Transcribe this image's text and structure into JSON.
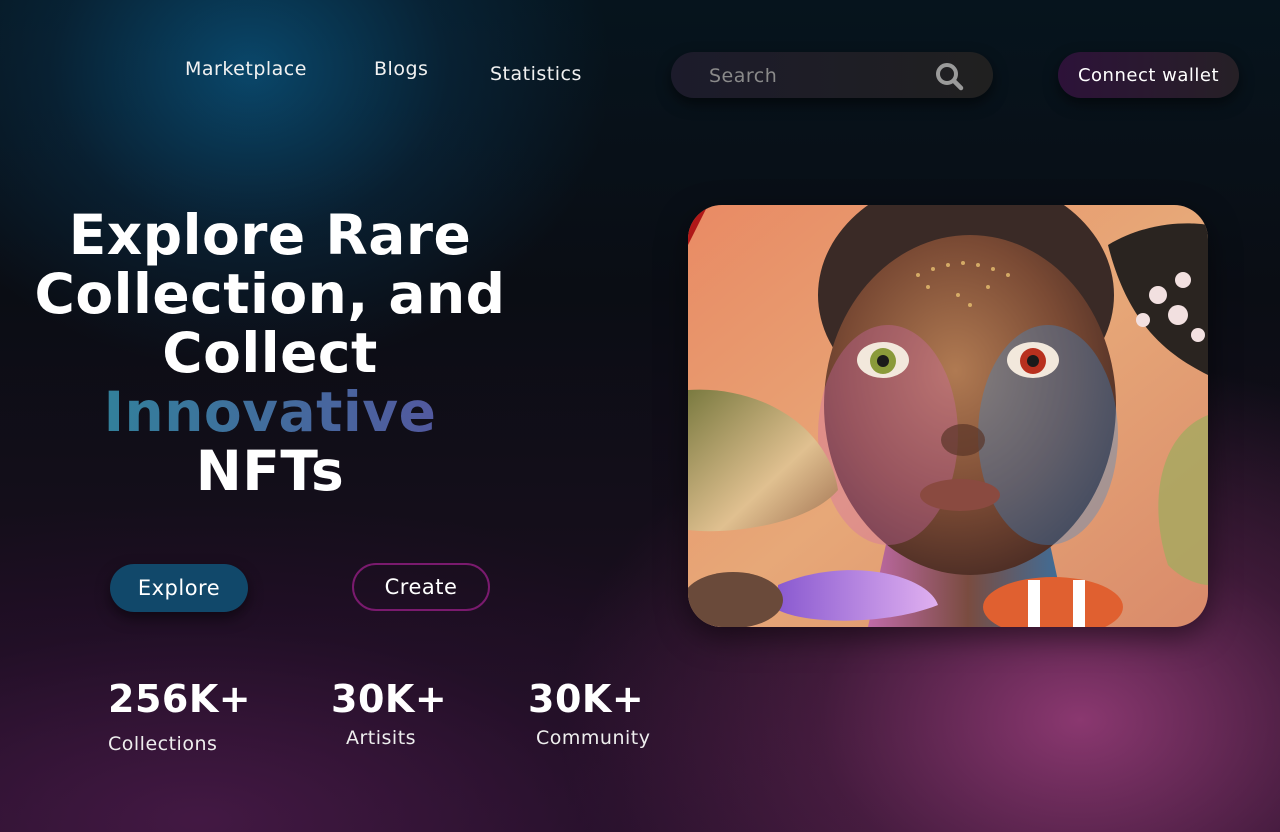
{
  "nav": {
    "links": [
      "Marketplace",
      "Blogs",
      "Statistics"
    ],
    "search_placeholder": "Search",
    "connect_label": "Connect  wallet"
  },
  "hero": {
    "line1": "Explore Rare",
    "line2": "Collection, and",
    "line3": "Collect",
    "accent": "Innovative",
    "line5": "NFTs",
    "explore_label": "Explore",
    "create_label": "Create"
  },
  "stats": [
    {
      "value": "256K+",
      "label": "Collections"
    },
    {
      "value": "30K+",
      "label": "Artisits"
    },
    {
      "value": "30K+",
      "label": "Community"
    }
  ],
  "colors": {
    "explore_button": "#11486a",
    "create_border": "#7a1a6e",
    "accent_start": "#2a8a9a",
    "accent_end": "#5a4fa0"
  }
}
